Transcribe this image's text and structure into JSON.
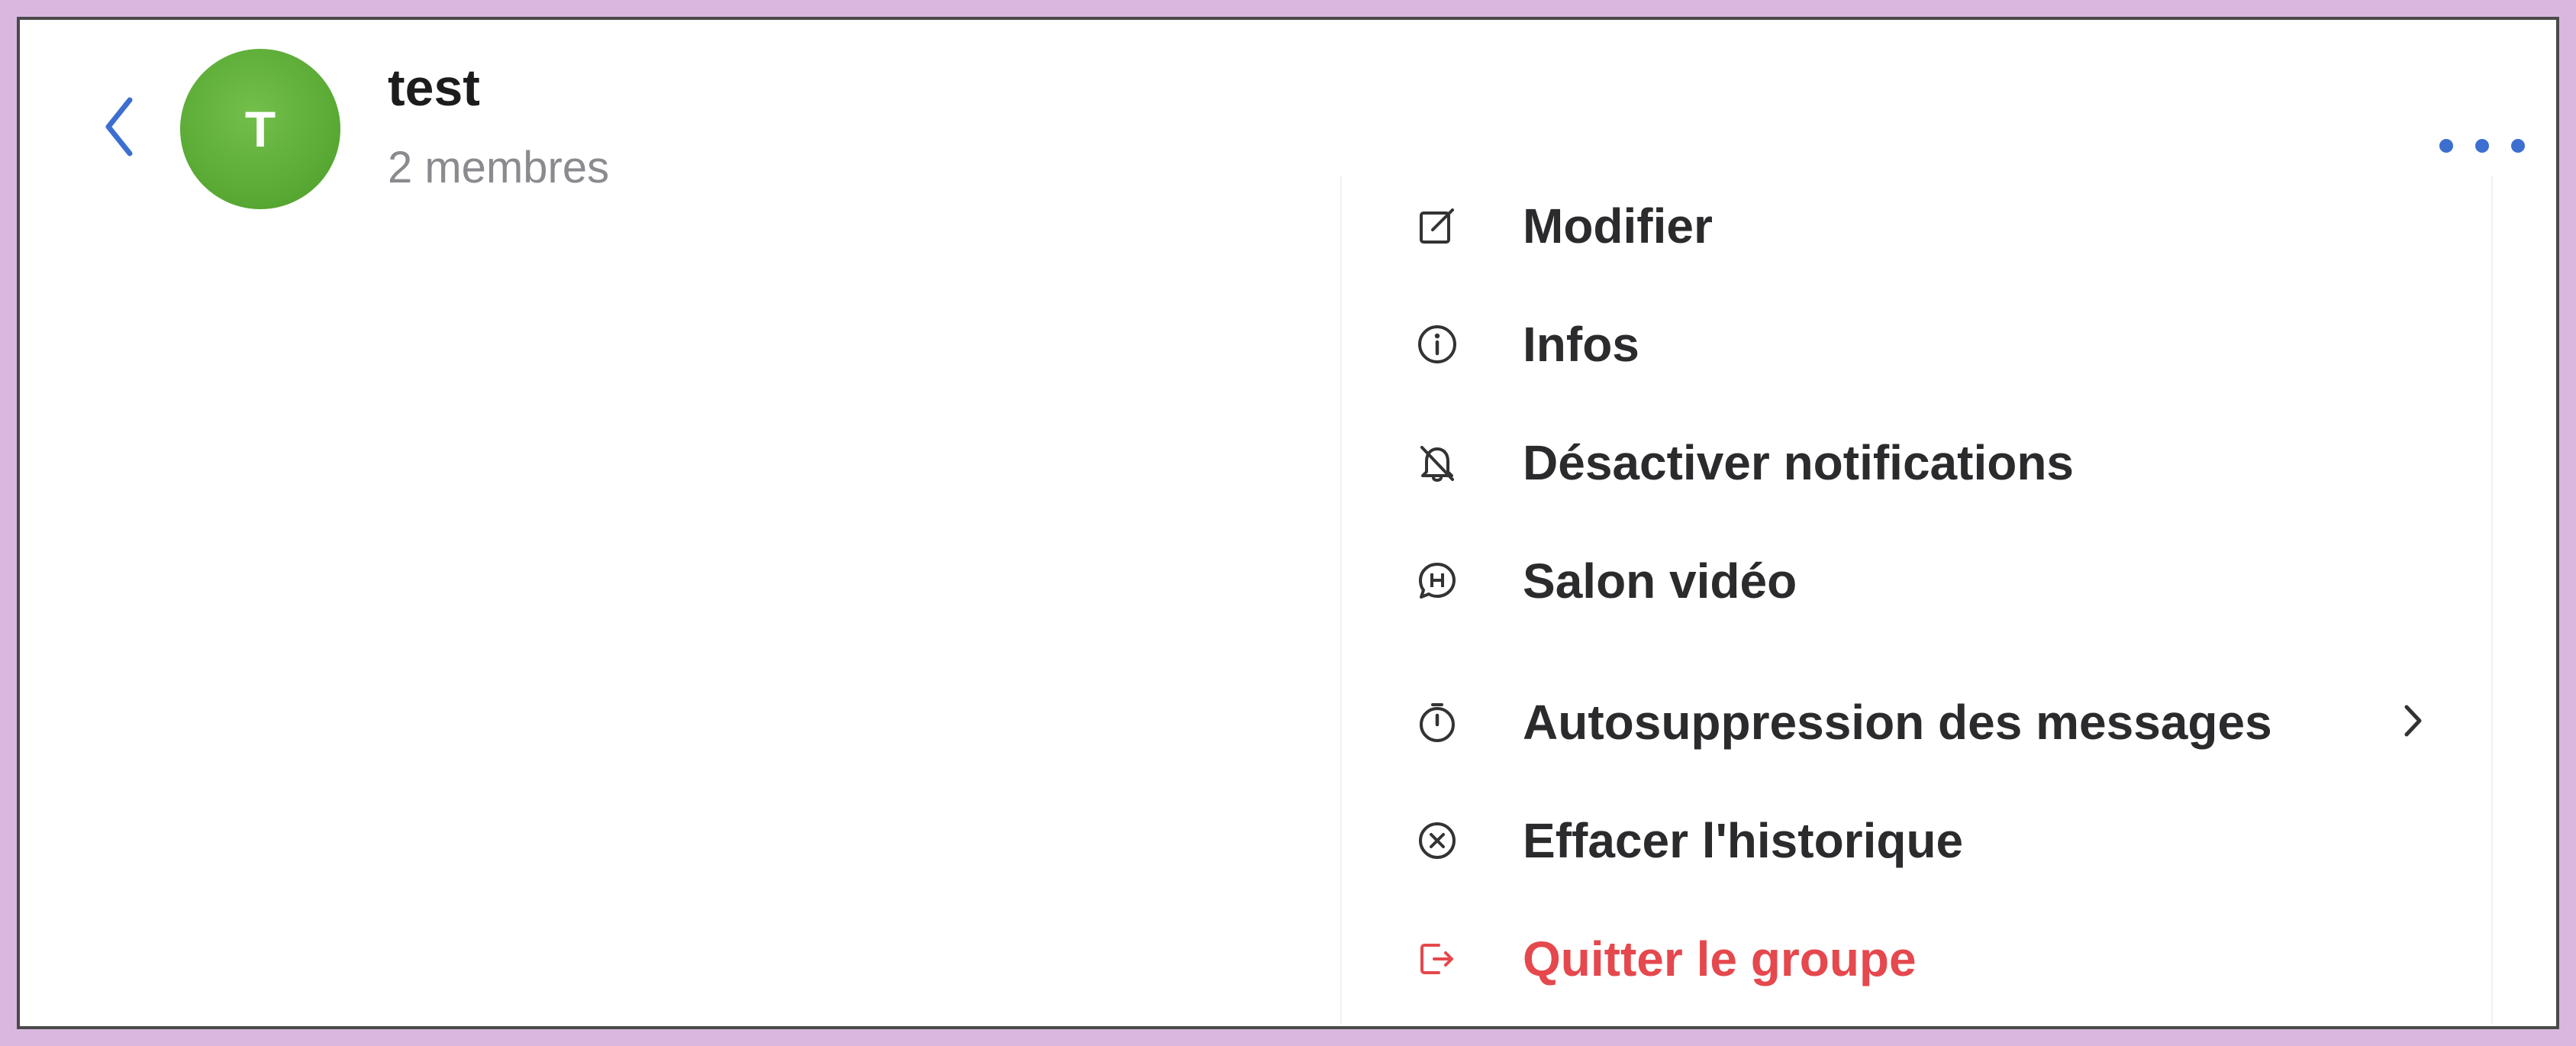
{
  "header": {
    "title": "test",
    "subtitle": "2 membres",
    "avatar_initial": "T",
    "avatar_color": "#57a833",
    "back_icon": "chevron-left-icon",
    "more_icon": "ellipsis-icon",
    "accent_color": "#3d6fd1"
  },
  "menu": {
    "items": [
      {
        "label": "Modifier",
        "icon": "edit-icon"
      },
      {
        "label": "Infos",
        "icon": "info-icon"
      },
      {
        "label": "Désactiver notifications",
        "icon": "bell-off-icon"
      },
      {
        "label": "Salon vidéo",
        "icon": "video-chat-icon"
      },
      {
        "label": "Autosuppression des messages",
        "icon": "timer-icon",
        "has_submenu": true
      },
      {
        "label": "Effacer l'historique",
        "icon": "clear-circle-icon"
      },
      {
        "label": "Quitter le groupe",
        "icon": "leave-icon",
        "danger": true
      }
    ],
    "danger_color": "#e5484d"
  }
}
